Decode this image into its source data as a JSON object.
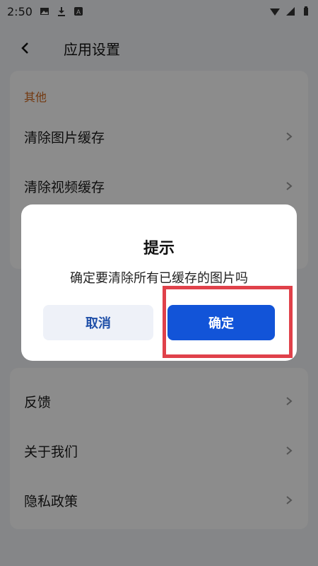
{
  "status_bar": {
    "time": "2:50"
  },
  "header": {
    "title": "应用设置"
  },
  "section_other": {
    "title": "其他",
    "items": [
      {
        "label": "清除图片缓存"
      },
      {
        "label": "清除视频缓存"
      }
    ]
  },
  "section_more": {
    "items": [
      {
        "label": "反馈"
      },
      {
        "label": "关于我们"
      },
      {
        "label": "隐私政策"
      }
    ]
  },
  "dialog": {
    "title": "提示",
    "message": "确定要清除所有已缓存的图片吗",
    "cancel_label": "取消",
    "confirm_label": "确定"
  },
  "colors": {
    "accent": "#1254d8",
    "section_title": "#d2691e",
    "highlight": "#e0414a"
  }
}
